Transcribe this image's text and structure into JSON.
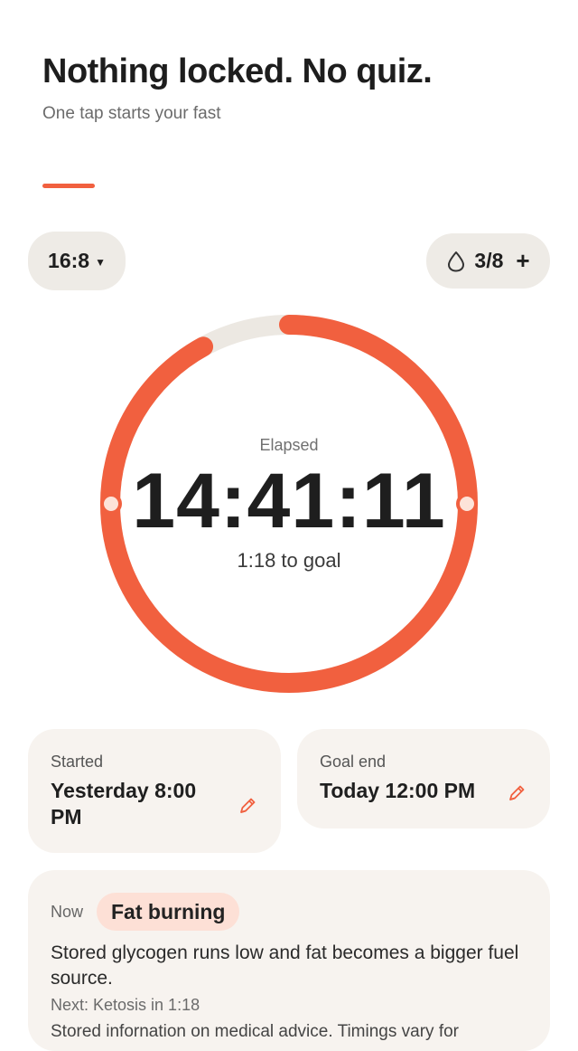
{
  "header": {
    "title": "Nothing locked. No quiz.",
    "subtitle": "One tap starts your fast"
  },
  "colors": {
    "accent": "#f1603f",
    "track": "#ece8e2",
    "pill_bg": "#eeebe6",
    "card_bg": "#f7f3ef",
    "badge_bg": "#fde0d6"
  },
  "protocol": {
    "label": "16:8",
    "icon": "chevron-down-icon"
  },
  "water": {
    "icon": "water-drop-icon",
    "count": "3/8",
    "add_label": "+"
  },
  "timer": {
    "label": "Elapsed",
    "value": "14:41:11",
    "remaining": "1:18 to goal",
    "progress": 0.92
  },
  "started": {
    "label": "Started",
    "value": "Yesterday 8:00 PM",
    "icon": "pencil-icon"
  },
  "goal_end": {
    "label": "Goal end",
    "value": "Today 12:00 PM",
    "icon": "pencil-icon"
  },
  "phase": {
    "now_label": "Now",
    "name": "Fat burning",
    "description": "Stored glycogen runs low and fat becomes a bigger fuel source.",
    "next": "Next: Ketosis in 1:18",
    "more": "Stored infornation on medical advice. Timings vary for"
  }
}
